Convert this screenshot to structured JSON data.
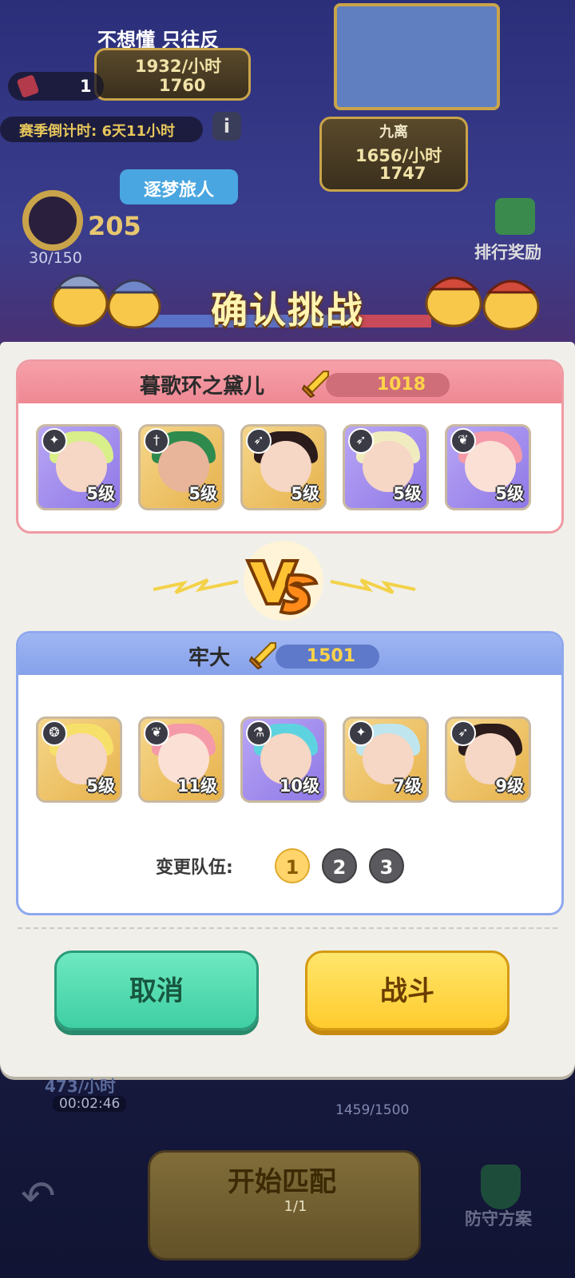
{
  "background": {
    "scroll_text": "不想懂 只往反",
    "left_income_rate": "1932/小时",
    "left_gold": "1760",
    "ticket_count": "1",
    "season_countdown": "赛季倒计时: 6天11小时",
    "right_player_name": "九离",
    "right_income_rate": "1656/小时",
    "right_gold": "1747",
    "rank_title": "逐梦旅人",
    "rank_points": "205",
    "rank_progress": "30/150",
    "ranking_reward": "排行奖励",
    "bottom_income": "473/小时",
    "bottom_timer": "00:02:46",
    "bottom_progress": "1459/1500",
    "start_match": "开始匹配",
    "match_tickets": "1/1",
    "defense_plan": "防守方案"
  },
  "dialog": {
    "title": "确认挑战",
    "enemy_team": {
      "name": "暮歌环之黛儿",
      "power": "1018",
      "heroes": [
        {
          "level": "5级",
          "frame": "purple",
          "class_icon": "mage-icon"
        },
        {
          "level": "5级",
          "frame": "gold",
          "class_icon": "warrior-icon"
        },
        {
          "level": "5级",
          "frame": "gold",
          "class_icon": "archer-icon"
        },
        {
          "level": "5级",
          "frame": "purple",
          "class_icon": "archer-icon"
        },
        {
          "level": "5级",
          "frame": "purple",
          "class_icon": "support-icon"
        }
      ]
    },
    "vs_label": "VS",
    "my_team": {
      "name": "牢大",
      "power": "1501",
      "heroes": [
        {
          "level": "5级",
          "frame": "gold",
          "class_icon": "beast-icon"
        },
        {
          "level": "11级",
          "frame": "gold",
          "class_icon": "support-icon"
        },
        {
          "level": "10级",
          "frame": "purple",
          "class_icon": "potion-icon"
        },
        {
          "level": "7级",
          "frame": "gold",
          "class_icon": "mage-icon"
        },
        {
          "level": "9级",
          "frame": "gold",
          "class_icon": "archer-icon"
        }
      ],
      "switch_label": "变更队伍:",
      "team_slots": [
        "1",
        "2",
        "3"
      ],
      "active_slot": "1"
    },
    "cancel_label": "取消",
    "fight_label": "战斗"
  },
  "colors": {
    "enemy_border": "#ef9aa3",
    "ally_border": "#8ea8ee",
    "cancel_green": "#3fcfa3",
    "fight_yellow": "#ffcb2e"
  }
}
